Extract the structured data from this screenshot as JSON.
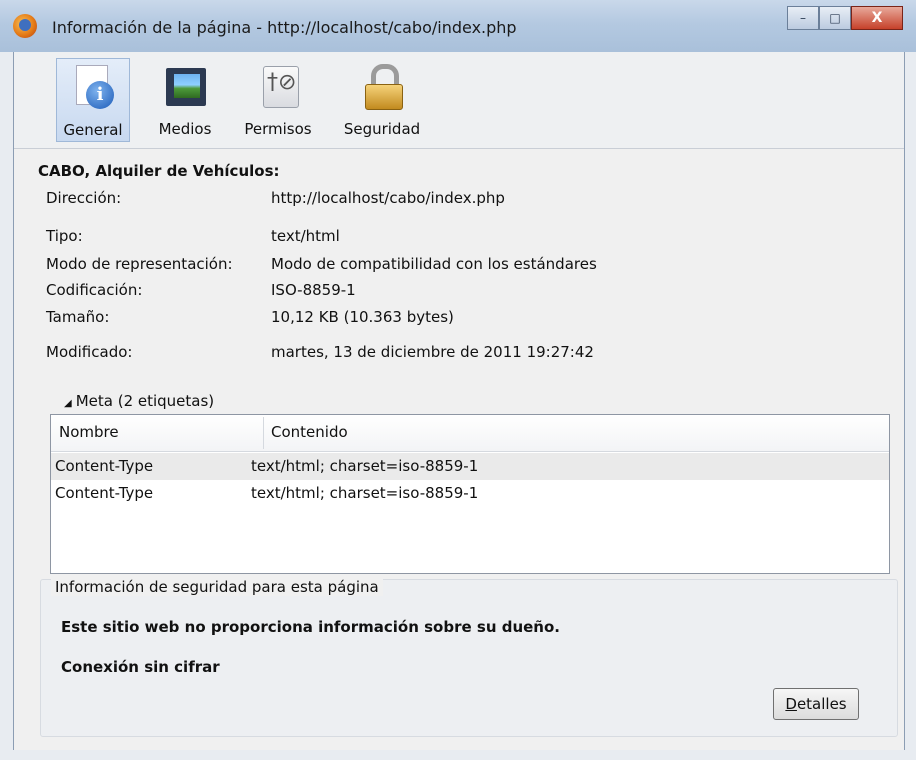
{
  "window": {
    "title": "Información de la página - http://localhost/cabo/index.php",
    "controls": {
      "minimize": "–",
      "maximize": "□",
      "close": "X"
    }
  },
  "toolbar": {
    "tabs": [
      {
        "label": "General",
        "icon": "info-icon",
        "selected": true
      },
      {
        "label": "Medios",
        "icon": "media-icon",
        "selected": false
      },
      {
        "label": "Permisos",
        "icon": "permissions-icon",
        "selected": false
      },
      {
        "label": "Seguridad",
        "icon": "lock-icon",
        "selected": false
      }
    ]
  },
  "general": {
    "page_title": "CABO, Alquiler de Vehículos:",
    "fields": [
      {
        "label": "Dirección:",
        "value": "http://localhost/cabo/index.php"
      },
      {
        "label": "Tipo:",
        "value": "text/html"
      },
      {
        "label": "Modo de representación:",
        "value": "Modo de compatibilidad con los estándares"
      },
      {
        "label": "Codificación:",
        "value": "ISO-8859-1"
      },
      {
        "label": "Tamaño:",
        "value": "10,12 KB (10.363 bytes)"
      },
      {
        "label": "Modificado:",
        "value": "martes, 13 de diciembre de 2011 19:27:42"
      }
    ]
  },
  "meta": {
    "legend": "Meta (2 etiquetas)",
    "columns": [
      "Nombre",
      "Contenido"
    ],
    "rows": [
      {
        "name": "Content-Type",
        "content": "text/html; charset=iso-8859-1"
      },
      {
        "name": "Content-Type",
        "content": "text/html; charset=iso-8859-1"
      }
    ]
  },
  "security": {
    "legend": "Información de seguridad para esta página",
    "owner_text": "Este sitio web no proporciona información sobre su dueño.",
    "connection_text": "Conexión sin cifrar",
    "details_button_accel": "D",
    "details_button_rest": "etalles"
  }
}
